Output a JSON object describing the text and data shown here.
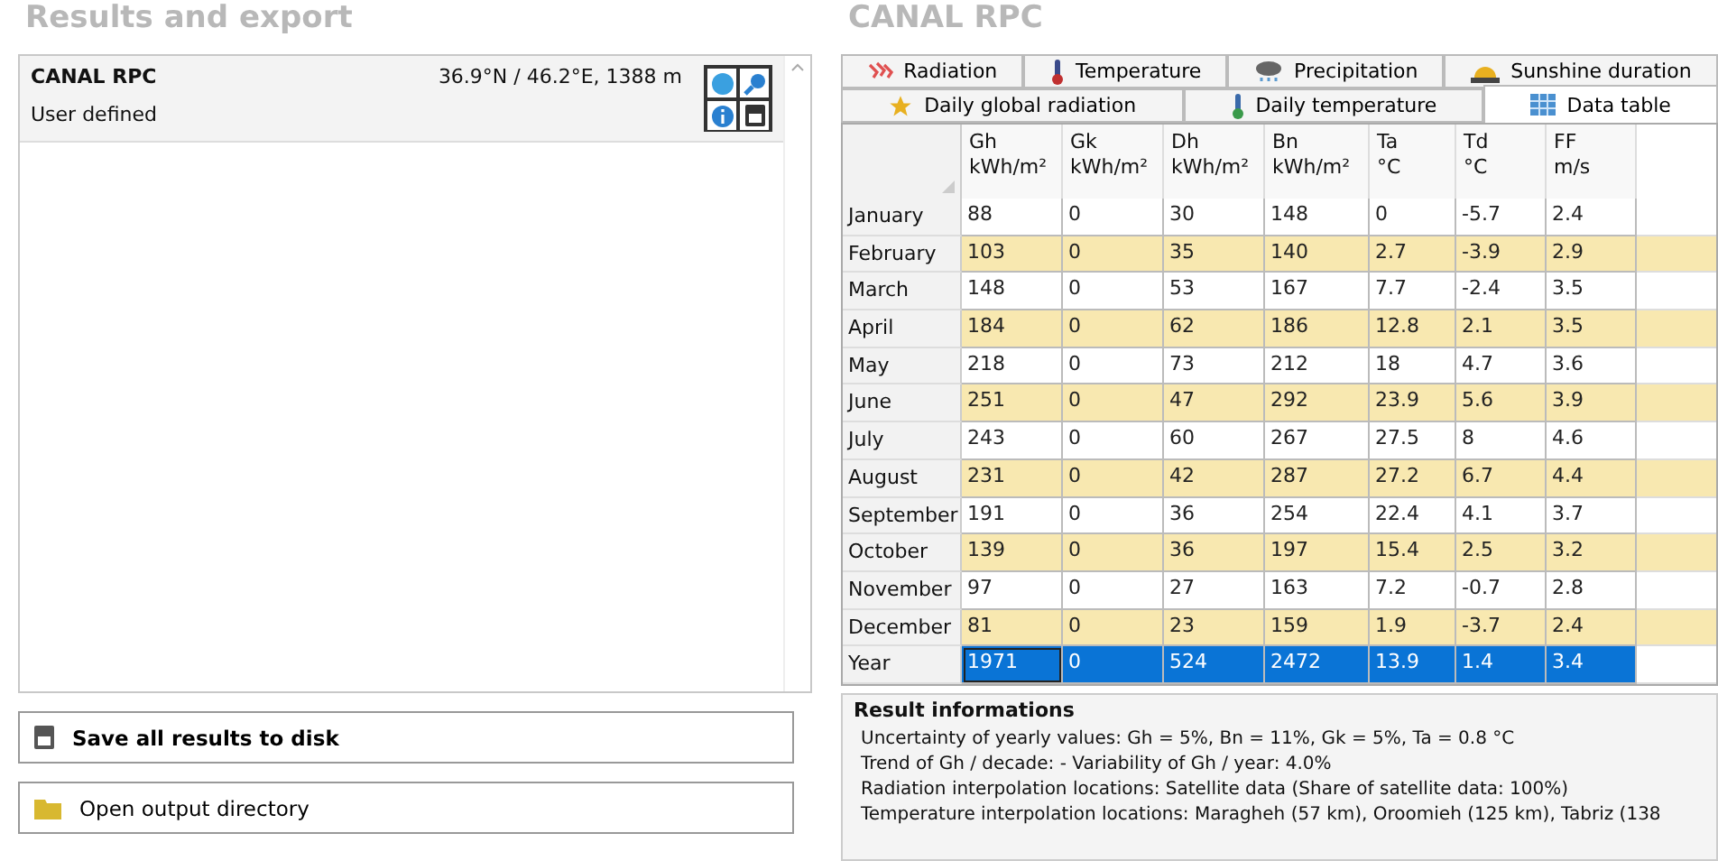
{
  "left_heading": "Results and export",
  "location": {
    "name": "CANAL RPC",
    "coords": "36.9°N / 46.2°E, 1388 m",
    "source": "User defined"
  },
  "buttons": [
    {
      "kind": "save",
      "label": "Save all results to disk"
    },
    {
      "kind": "folder",
      "label": "Open output directory"
    }
  ],
  "right_heading": "CANAL RPC",
  "tabs": [
    [
      {
        "kind": "radiation",
        "label": "Radiation",
        "selected": false
      },
      {
        "kind": "temperature",
        "label": "Temperature",
        "selected": false
      },
      {
        "kind": "precipitation",
        "label": "Precipitation",
        "selected": false
      },
      {
        "kind": "sunshine",
        "label": "Sunshine duration",
        "selected": false
      }
    ],
    [
      {
        "kind": "star",
        "label": "Daily global radiation",
        "selected": false
      },
      {
        "kind": "daily_temperature",
        "label": "Daily temperature",
        "selected": false
      },
      {
        "kind": "table",
        "label": "Data table",
        "selected": true
      }
    ]
  ],
  "table": {
    "columns": [
      {
        "name": "Gh",
        "unit": "kWh/m²"
      },
      {
        "name": "Gk",
        "unit": "kWh/m²"
      },
      {
        "name": "Dh",
        "unit": "kWh/m²"
      },
      {
        "name": "Bn",
        "unit": "kWh/m²"
      },
      {
        "name": "Ta",
        "unit": "°C"
      },
      {
        "name": "Td",
        "unit": "°C"
      },
      {
        "name": "FF",
        "unit": "m/s"
      }
    ],
    "rows": [
      {
        "label": "January",
        "cells": [
          "88",
          "0",
          "30",
          "148",
          "0",
          "-5.7",
          "2.4"
        ],
        "selected": false
      },
      {
        "label": "February",
        "cells": [
          "103",
          "0",
          "35",
          "140",
          "2.7",
          "-3.9",
          "2.9"
        ],
        "selected": false
      },
      {
        "label": "March",
        "cells": [
          "148",
          "0",
          "53",
          "167",
          "7.7",
          "-2.4",
          "3.5"
        ],
        "selected": false
      },
      {
        "label": "April",
        "cells": [
          "184",
          "0",
          "62",
          "186",
          "12.8",
          "2.1",
          "3.5"
        ],
        "selected": false
      },
      {
        "label": "May",
        "cells": [
          "218",
          "0",
          "73",
          "212",
          "18",
          "4.7",
          "3.6"
        ],
        "selected": false
      },
      {
        "label": "June",
        "cells": [
          "251",
          "0",
          "47",
          "292",
          "23.9",
          "5.6",
          "3.9"
        ],
        "selected": false
      },
      {
        "label": "July",
        "cells": [
          "243",
          "0",
          "60",
          "267",
          "27.5",
          "8",
          "4.6"
        ],
        "selected": false
      },
      {
        "label": "August",
        "cells": [
          "231",
          "0",
          "42",
          "287",
          "27.2",
          "6.7",
          "4.4"
        ],
        "selected": false
      },
      {
        "label": "September",
        "cells": [
          "191",
          "0",
          "36",
          "254",
          "22.4",
          "4.1",
          "3.7"
        ],
        "selected": false
      },
      {
        "label": "October",
        "cells": [
          "139",
          "0",
          "36",
          "197",
          "15.4",
          "2.5",
          "3.2"
        ],
        "selected": false
      },
      {
        "label": "November",
        "cells": [
          "97",
          "0",
          "27",
          "163",
          "7.2",
          "-0.7",
          "2.8"
        ],
        "selected": false
      },
      {
        "label": "December",
        "cells": [
          "81",
          "0",
          "23",
          "159",
          "1.9",
          "-3.7",
          "2.4"
        ],
        "selected": false
      },
      {
        "label": "Year",
        "cells": [
          "1971",
          "0",
          "524",
          "2472",
          "13.9",
          "1.4",
          "3.4"
        ],
        "selected": true
      }
    ]
  },
  "result_info": {
    "title": "Result informations",
    "lines": [
      "Uncertainty of yearly values: Gh = 5%, Bn = 11%, Gk = 5%, Ta = 0.8 °C",
      "Trend of Gh / decade: -   Variability of Gh / year: 4.0%",
      "Radiation interpolation locations: Satellite data  (Share of satellite data: 100%)",
      "Temperature interpolation locations: Maragheh (57 km), Oroomieh (125 km), Tabriz (138"
    ]
  }
}
